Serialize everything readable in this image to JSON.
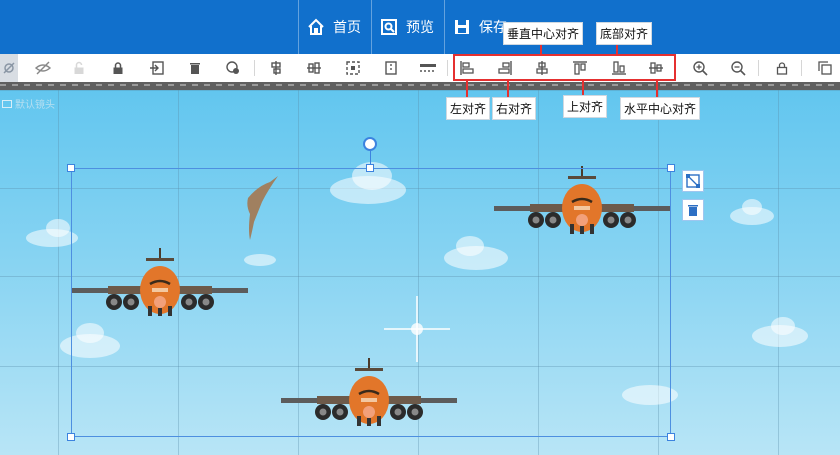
{
  "topnav": {
    "items": [
      {
        "key": "home",
        "label": "首页",
        "icon": "home-icon"
      },
      {
        "key": "preview",
        "label": "预览",
        "icon": "preview-icon"
      },
      {
        "key": "save",
        "label": "保存",
        "icon": "save-icon"
      }
    ]
  },
  "toolbar": {
    "tools": [
      "select-icon",
      "hide-icon",
      "unlock-icon",
      "lock-icon",
      "export-icon",
      "delete-icon",
      "layer-icon",
      "distribute-h-icon",
      "distribute-v-icon",
      "group-icon",
      "ungroup-icon",
      "fit-width-icon",
      "align-left-icon",
      "align-right-icon",
      "align-center-v-icon",
      "align-top-icon",
      "align-bottom-icon",
      "align-center-h-icon",
      "zoom-in-icon",
      "zoom-out-icon",
      "lock-canvas-icon",
      "copy-icon"
    ]
  },
  "annotations": {
    "vertical_center": "垂直中心对齐",
    "bottom": "底部对齐",
    "left": "左对齐",
    "right": "右对齐",
    "top": "上对齐",
    "horizontal_center": "水平中心对齐"
  },
  "stage": {
    "camera_label": "默认镜头"
  },
  "colors": {
    "topbar": "#1170cc",
    "highlight": "#e53030",
    "selection": "#3c83df",
    "plane_body": "#e2762a"
  }
}
